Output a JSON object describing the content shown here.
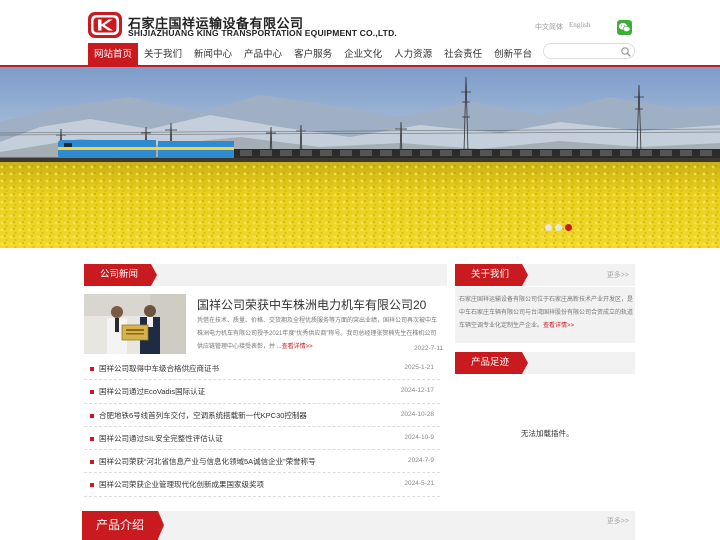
{
  "header": {
    "company_cn": "石家庄国祥运输设备有限公司",
    "company_en": "SHIJIAZHUANG KING TRANSPORTATION EQUIPMENT CO.,LTD.",
    "lang_cn": "中文简体",
    "lang_en": "English",
    "wechat_icon": "wechat-icon",
    "search_icon": "search-icon",
    "search_placeholder": ""
  },
  "nav": {
    "items": [
      {
        "label": "网站首页",
        "active": true
      },
      {
        "label": "关于我们"
      },
      {
        "label": "新闻中心"
      },
      {
        "label": "产品中心"
      },
      {
        "label": "客户服务"
      },
      {
        "label": "企业文化"
      },
      {
        "label": "人力资源"
      },
      {
        "label": "社会责任"
      },
      {
        "label": "创新平台"
      }
    ]
  },
  "colors": {
    "brand_red": "#c81a1f",
    "panel_gray": "#f2f2f2"
  },
  "banner": {
    "slide_count": 3,
    "active_slide": 3
  },
  "news": {
    "title": "公司新闻",
    "featured": {
      "title": "国祥公司荣获中车株洲电力机车有限公司20",
      "summary": "凭借在技术、质量、价格、交货期及全程优质服务等方面的突出业绩，国祥公司再次被中车株洲电力机车有限公司授予2021年度“优秀供应商”称号。我司总经理张贺楠先生在株机公司供应链管理中心接受表彰，并 ...",
      "more_label": "查看详情>>",
      "date": "2022-7-11"
    },
    "items": [
      {
        "title": "国祥公司取得中车级合格供应商证书",
        "date": "2025-1-21"
      },
      {
        "title": "国祥公司通过EcoVadis国际认证",
        "date": "2024-12-17"
      },
      {
        "title": "合肥地铁6号线首列车交付，空调系统搭载新一代KPC30控制器",
        "date": "2024-10-28"
      },
      {
        "title": "国祥公司通过SIL安全完整性评估认证",
        "date": "2024-10-9"
      },
      {
        "title": "国祥公司荣获“河北省信息产业与信息化领域5A诚信企业”荣誉称号",
        "date": "2024-7-9"
      },
      {
        "title": "国祥公司荣获企业管理现代化创新成果国家级奖项",
        "date": "2024-5-21"
      }
    ]
  },
  "about": {
    "title": "关于我们",
    "more_label": "更多>>",
    "text": "石家庄国祥运输设备有限公司位于石家庄高新技术产业开发区，是中车石家庄车辆有限公司与台湾国祥股份有限公司合资成立的轨道车辆空调专业化定制生产企业。",
    "detail_label": "查看详情>>"
  },
  "products_track": {
    "title": "产品足迹",
    "empty_message": "无法加载插件。"
  },
  "products_intro": {
    "title": "产品介绍",
    "more_label": "更多>>"
  }
}
